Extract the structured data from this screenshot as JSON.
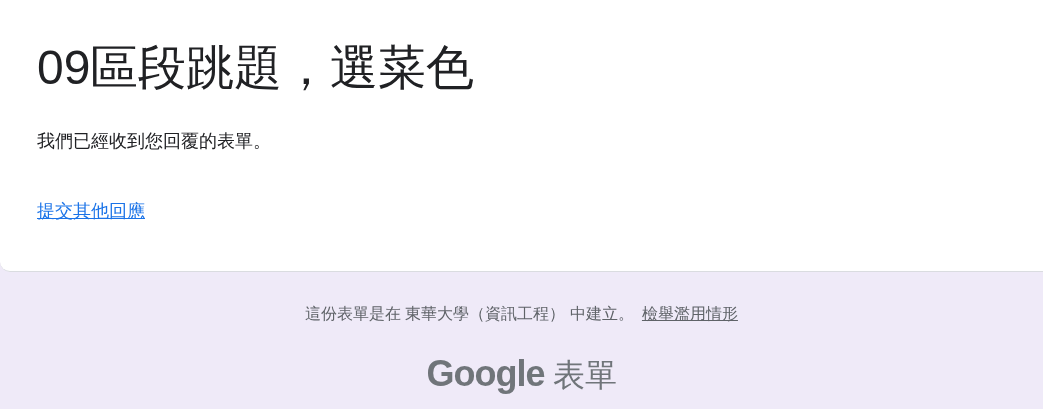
{
  "card": {
    "title": "09區段跳題，選菜色",
    "message": "我們已經收到您回覆的表單。",
    "link": "提交其他回應"
  },
  "footer": {
    "notice": "這份表單是在 東華大學（資訊工程） 中建立。",
    "report_link": "檢舉濫用情形",
    "brand": "Google",
    "product": "表單"
  }
}
